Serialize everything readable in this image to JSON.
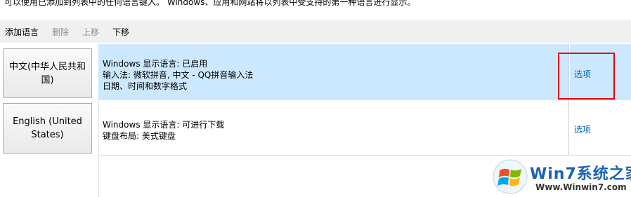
{
  "intro_text": "可以使用已添加到列表中的任何语言键入。 Windows、应用和网站将以列表中受支持的第一种语言进行显示。",
  "toolbar": {
    "add_label": "添加语言",
    "delete_label": "删除",
    "move_up_label": "上移",
    "move_down_label": "下移"
  },
  "languages": [
    {
      "name": "中文(中华人民共和国)",
      "lines": [
        "Windows 显示语言: 已启用",
        "输入法: 微软拼音, 中文 - QQ拼音输入法",
        "日期、时间和数字格式"
      ],
      "options_label": "选项",
      "selected": true
    },
    {
      "name": "English (United States)",
      "lines": [
        "Windows 显示语言: 可进行下载",
        "键盘布局: 美式键盘"
      ],
      "options_label": "选项",
      "selected": false
    }
  ],
  "watermark": {
    "title": "Win7系统之家",
    "url": "Www.Winwin7.com"
  },
  "colors": {
    "selected_row": "#cce8ff",
    "link": "#0066cc",
    "highlight_border": "#e60012",
    "toolbar_bg": "#f0f0f0"
  }
}
